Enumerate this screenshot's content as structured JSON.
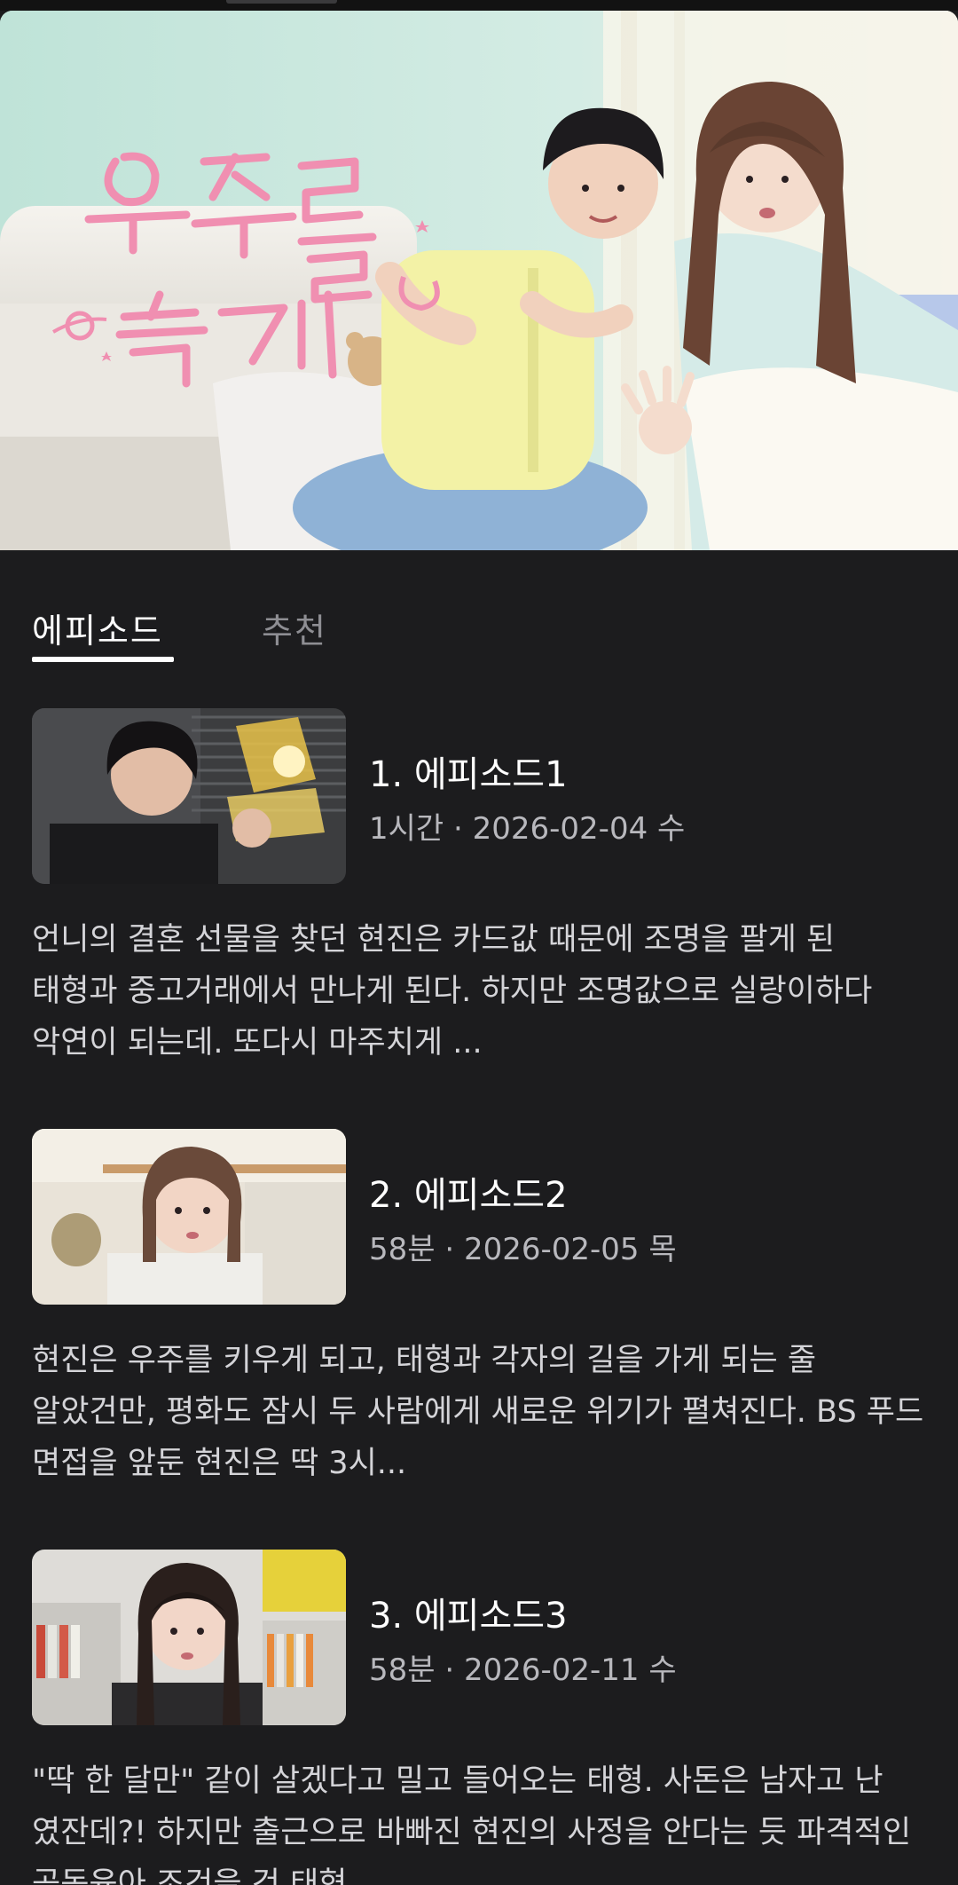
{
  "hero": {
    "title_art": "우주를 줄게"
  },
  "tabs": [
    {
      "label": "에피소드",
      "selected": true
    },
    {
      "label": "추천",
      "selected": false
    }
  ],
  "episodes": [
    {
      "title": "1. 에피소드1",
      "meta": "1시간 · 2026-02-04 수",
      "description": "언니의 결혼 선물을 찾던 현진은 카드값 때문에 조명을 팔게 된 태형과 중고거래에서 만나게 된다. 하지만 조명값으로 실랑이하다 악연이 되는데. 또다시 마주치게 ..."
    },
    {
      "title": "2. 에피소드2",
      "meta": "58분 · 2026-02-05 목",
      "description": "현진은 우주를 키우게 되고, 태형과 각자의 길을 가게 되는 줄 알았건만, 평화도 잠시 두 사람에게 새로운 위기가 펼쳐진다. BS 푸드 면접을 앞둔 현진은 딱 3시..."
    },
    {
      "title": "3. 에피소드3",
      "meta": "58분 · 2026-02-11 수",
      "description": "\"딱 한 달만\" 같이 살겠다고 밀고 들어오는 태형. 사돈은 남자고 난 였잔데?! 하지만 출근으로 바빠진 현진의 사정을 안다는 듯 파격적인 공동육아 조건을 건 태형"
    }
  ]
}
